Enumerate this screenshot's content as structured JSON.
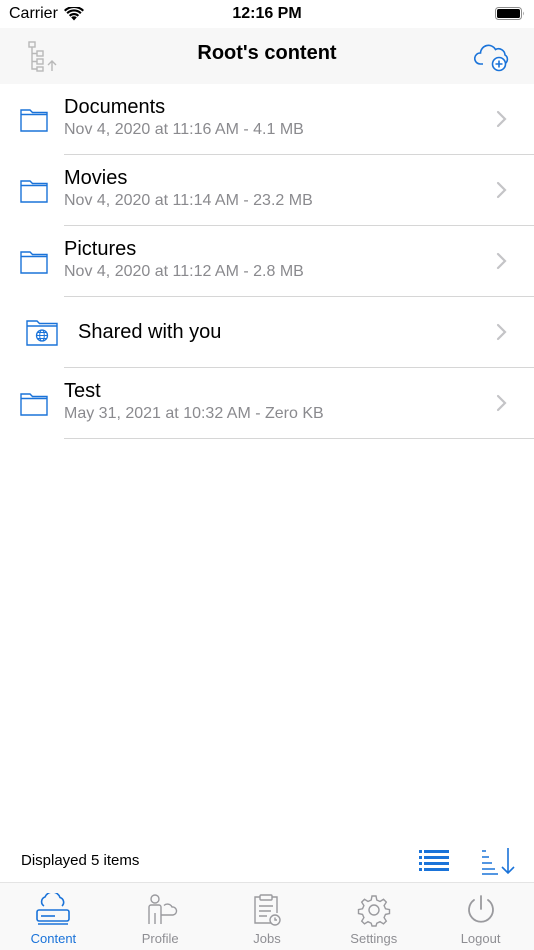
{
  "status_bar": {
    "carrier": "Carrier",
    "time": "12:16 PM"
  },
  "nav": {
    "title": "Root's content",
    "left_icon": "folder-tree-up-icon",
    "right_icon": "cloud-add-icon"
  },
  "items": [
    {
      "name": "Documents",
      "meta": "Nov 4, 2020 at 11:16 AM - 4.1 MB",
      "icon": "folder-icon"
    },
    {
      "name": "Movies",
      "meta": "Nov 4, 2020 at 11:14 AM - 23.2 MB",
      "icon": "folder-icon"
    },
    {
      "name": "Pictures",
      "meta": "Nov 4, 2020 at 11:12 AM - 2.8 MB",
      "icon": "folder-icon"
    },
    {
      "name": "Shared with you",
      "meta": "",
      "icon": "shared-folder-icon"
    },
    {
      "name": "Test",
      "meta": "May 31, 2021 at 10:32 AM - Zero KB",
      "icon": "folder-icon"
    }
  ],
  "footer": {
    "count_text": "Displayed 5 items"
  },
  "tabs": [
    {
      "label": "Content",
      "icon": "server-cloud-icon",
      "active": true
    },
    {
      "label": "Profile",
      "icon": "profile-icon",
      "active": false
    },
    {
      "label": "Jobs",
      "icon": "clipboard-clock-icon",
      "active": false
    },
    {
      "label": "Settings",
      "icon": "gear-icon",
      "active": false
    },
    {
      "label": "Logout",
      "icon": "power-icon",
      "active": false
    }
  ],
  "colors": {
    "accent": "#1a73d9",
    "secondary_text": "#8a8a8e",
    "inactive_tab": "#8e8e93"
  }
}
